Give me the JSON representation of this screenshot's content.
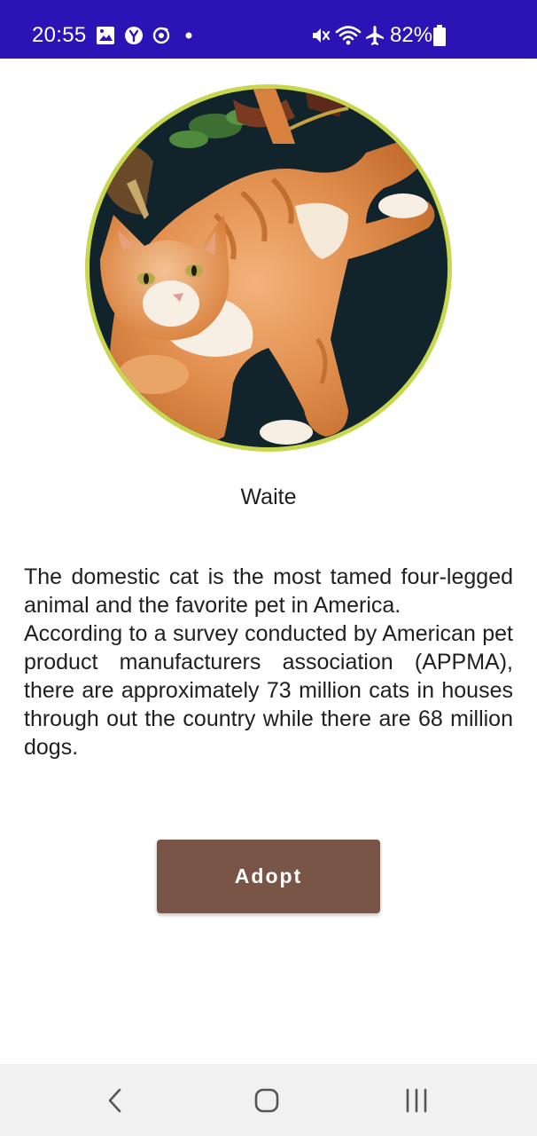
{
  "status_bar": {
    "time": "20:55",
    "battery_percent": "82%",
    "background_color": "#2b14b5",
    "notification_icons": [
      "gallery-icon",
      "yandex-icon",
      "sync-icon",
      "dot-icon"
    ],
    "system_icons": [
      "mute-icon",
      "wifi-icon",
      "airplane-icon",
      "battery-icon"
    ]
  },
  "pet": {
    "name": "Waite",
    "photo_icon": "orange-tabby-cat-photo",
    "ring_color": "#c9d64f",
    "description": "The domestic cat is the most tamed four-legged animal and the favorite pet in America.\nAccording to a survey conducted by American pet product manufacturers association (APPMA), there are approximately 73 million cats in houses through out the country while there are 68 million dogs."
  },
  "actions": {
    "adopt_label": "Adopt",
    "adopt_color": "#795548"
  },
  "nav_bar": {
    "items": [
      "back-icon",
      "home-icon",
      "recents-icon"
    ]
  }
}
